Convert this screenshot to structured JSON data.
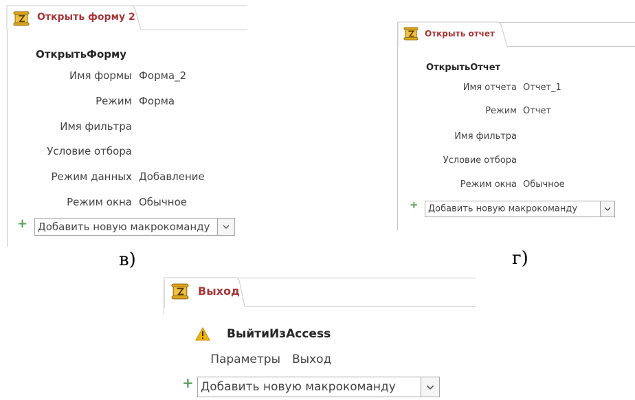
{
  "panel_v": {
    "tab_title": "Открыть форму 2",
    "action": "ОткрытьФорму",
    "args": [
      {
        "label": "Имя формы",
        "value": "Форма_2"
      },
      {
        "label": "Режим",
        "value": "Форма"
      },
      {
        "label": "Имя фильтра",
        "value": ""
      },
      {
        "label": "Условие отбора",
        "value": ""
      },
      {
        "label": "Режим данных",
        "value": "Добавление"
      },
      {
        "label": "Режим окна",
        "value": "Обычное"
      }
    ],
    "add_plus": "+",
    "add_label": "Добавить новую макрокоманду"
  },
  "panel_g": {
    "tab_title": "Открыть отчет",
    "action": "ОткрытьОтчет",
    "args": [
      {
        "label": "Имя отчета",
        "value": "Отчет_1"
      },
      {
        "label": "Режим",
        "value": "Отчет"
      },
      {
        "label": "Имя фильтра",
        "value": ""
      },
      {
        "label": "Условие отбора",
        "value": ""
      },
      {
        "label": "Режим окна",
        "value": "Обычное"
      }
    ],
    "add_plus": "+",
    "add_label": "Добавить новую макрокоманду"
  },
  "panel_exit": {
    "tab_title": "Выход",
    "action": "ВыйтиИзAccess",
    "args": [
      {
        "label": "Параметры",
        "value": "Выход"
      }
    ],
    "add_plus": "+",
    "add_label": "Добавить новую макрокоманду"
  },
  "captions": {
    "v": "в)",
    "g": "г)"
  },
  "icons": {
    "macro": "macro-scroll-icon",
    "warning": "warning-icon",
    "dropdown": "chevron-down-icon"
  },
  "colors": {
    "tab_title": "#a4373a",
    "plus": "#58a05a",
    "warning": "#f0b400"
  }
}
